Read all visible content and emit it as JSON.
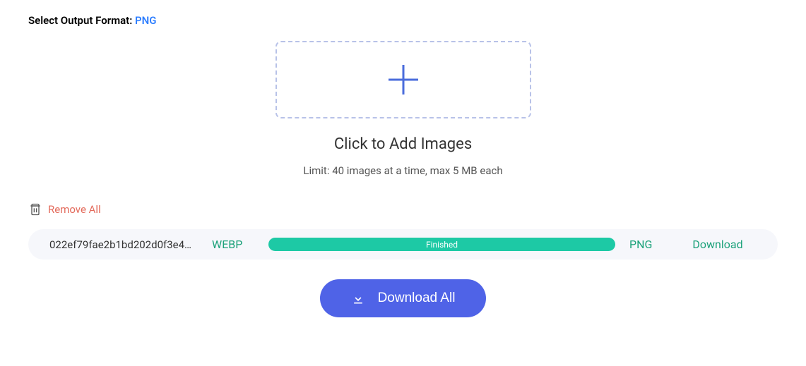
{
  "format_selector": {
    "label": "Select Output Format: ",
    "value": "PNG"
  },
  "dropzone": {
    "title": "Click to Add Images",
    "limit_text": "Limit: 40 images at a time, max 5 MB each"
  },
  "remove_all": {
    "label": "Remove All"
  },
  "files": [
    {
      "name": "022ef79fae2b1bd202d0f3e4…",
      "src_format": "WEBP",
      "progress_status": "Finished",
      "dst_format": "PNG",
      "download_label": "Download"
    }
  ],
  "download_all": {
    "label": "Download All"
  }
}
